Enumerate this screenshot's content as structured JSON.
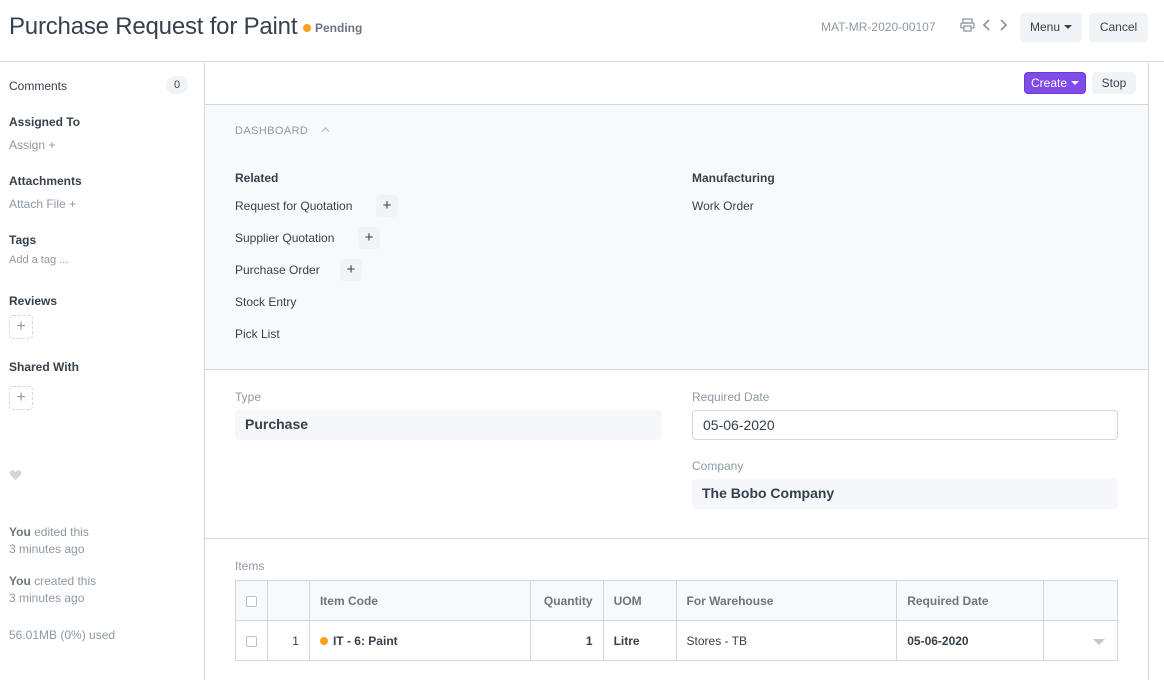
{
  "header": {
    "title": "Purchase Request for Paint",
    "status": "Pending",
    "status_color": "#ff9f1a",
    "doc_name": "MAT-MR-2020-00107",
    "menu_label": "Menu",
    "cancel_label": "Cancel",
    "icons": [
      "printer-icon",
      "chevron-left-icon",
      "chevron-right-icon"
    ]
  },
  "toolbar": {
    "create_label": "Create",
    "stop_label": "Stop",
    "accent": "#7f4ce8"
  },
  "sidebar": {
    "comments_label": "Comments",
    "comments_count": "0",
    "assigned_label": "Assigned To",
    "assign_link": "Assign +",
    "attachments_label": "Attachments",
    "attach_link": "Attach File +",
    "tags_label": "Tags",
    "add_tag": "Add a tag ...",
    "reviews_label": "Reviews",
    "shared_label": "Shared With",
    "edited_by": "You",
    "edited_text": " edited this",
    "edited_time": "3 minutes ago",
    "created_by": "You",
    "created_text": " created this",
    "created_time": "3 minutes ago",
    "usage": "56.01MB (0%) used"
  },
  "dashboard": {
    "heading": "DASHBOARD",
    "related_title": "Related",
    "related_items": [
      "Request for Quotation",
      "Supplier Quotation",
      "Purchase Order",
      "Stock Entry",
      "Pick List"
    ],
    "manufacturing_title": "Manufacturing",
    "manufacturing_items": [
      "Work Order"
    ]
  },
  "form": {
    "type_label": "Type",
    "type_value": "Purchase",
    "required_date_label": "Required Date",
    "required_date_value": "05-06-2020",
    "company_label": "Company",
    "company_value": "The Bobo Company"
  },
  "items": {
    "label": "Items",
    "columns": [
      "Item Code",
      "Quantity",
      "UOM",
      "For Warehouse",
      "Required Date"
    ],
    "rows": [
      {
        "idx": "1",
        "item_code": "IT - 6: Paint",
        "quantity": "1",
        "uom": "Litre",
        "warehouse": "Stores - TB",
        "required_date": "05-06-2020"
      }
    ]
  }
}
